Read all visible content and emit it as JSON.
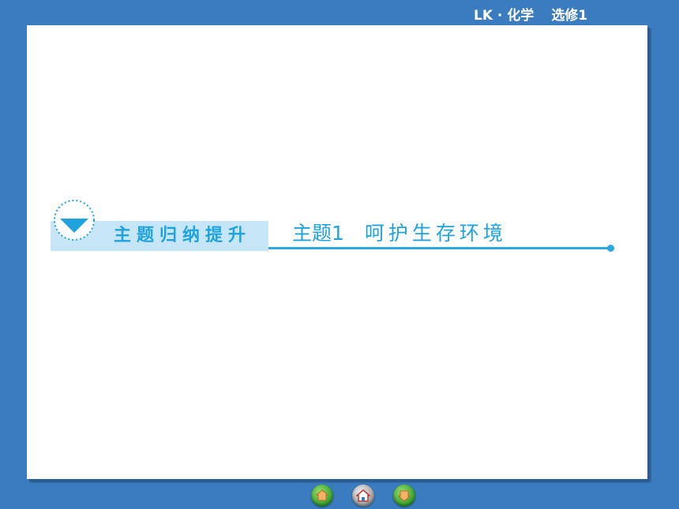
{
  "header": {
    "publisher": "LK · 化学",
    "volume": "选修1"
  },
  "slide": {
    "banner_label": "主题归纳提升",
    "topic_number": "主题1",
    "topic_title": "呵护生存环境"
  },
  "nav": [
    {
      "name": "prev-page-button",
      "icon": "home-arrow-left-icon"
    },
    {
      "name": "home-button",
      "icon": "house-icon"
    },
    {
      "name": "next-page-button",
      "icon": "home-arrow-right-icon"
    }
  ],
  "colors": {
    "background": "#3a7cbf",
    "accent": "#1fa3dc",
    "banner": "#c6e6f7"
  }
}
